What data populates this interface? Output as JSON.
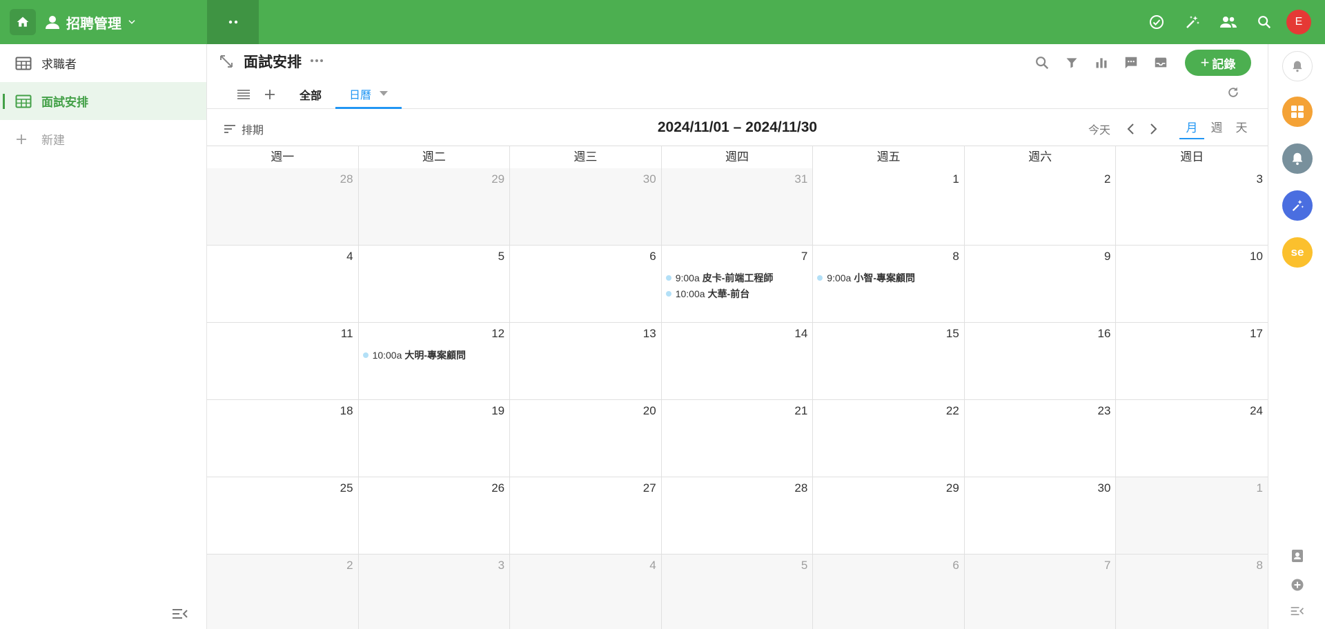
{
  "app": {
    "title": "招聘管理"
  },
  "user": {
    "avatar_letter": "E"
  },
  "sidebar": {
    "items": [
      {
        "label": "求職者"
      },
      {
        "label": "面試安排"
      }
    ],
    "new_label": "新建"
  },
  "view": {
    "title": "面試安排",
    "add_record_label": "記錄",
    "tabs": [
      {
        "label": "全部"
      },
      {
        "label": "日曆"
      }
    ]
  },
  "calendar": {
    "sort_label": "排期",
    "range": "2024/11/01 – 2024/11/30",
    "today_label": "今天",
    "modes": [
      "月",
      "週",
      "天"
    ],
    "weekdays": [
      "週一",
      "週二",
      "週三",
      "週四",
      "週五",
      "週六",
      "週日"
    ],
    "days": [
      {
        "n": "28",
        "out": true
      },
      {
        "n": "29",
        "out": true
      },
      {
        "n": "30",
        "out": true
      },
      {
        "n": "31",
        "out": true
      },
      {
        "n": "1"
      },
      {
        "n": "2"
      },
      {
        "n": "3"
      },
      {
        "n": "4"
      },
      {
        "n": "5"
      },
      {
        "n": "6"
      },
      {
        "n": "7",
        "events": [
          {
            "time": "9:00a",
            "title": "皮卡-前端工程師"
          },
          {
            "time": "10:00a",
            "title": "大華-前台"
          }
        ]
      },
      {
        "n": "8",
        "events": [
          {
            "time": "9:00a",
            "title": "小智-專案顧問"
          }
        ]
      },
      {
        "n": "9"
      },
      {
        "n": "10"
      },
      {
        "n": "11"
      },
      {
        "n": "12",
        "events": [
          {
            "time": "10:00a",
            "title": "大明-專案顧問"
          }
        ]
      },
      {
        "n": "13"
      },
      {
        "n": "14"
      },
      {
        "n": "15"
      },
      {
        "n": "16"
      },
      {
        "n": "17"
      },
      {
        "n": "18"
      },
      {
        "n": "19"
      },
      {
        "n": "20"
      },
      {
        "n": "21"
      },
      {
        "n": "22"
      },
      {
        "n": "23"
      },
      {
        "n": "24"
      },
      {
        "n": "25"
      },
      {
        "n": "26"
      },
      {
        "n": "27"
      },
      {
        "n": "28"
      },
      {
        "n": "29"
      },
      {
        "n": "30"
      },
      {
        "n": "1",
        "out": true
      },
      {
        "n": "2",
        "out": true
      },
      {
        "n": "3",
        "out": true
      },
      {
        "n": "4",
        "out": true
      },
      {
        "n": "5",
        "out": true
      },
      {
        "n": "6",
        "out": true
      },
      {
        "n": "7",
        "out": true
      },
      {
        "n": "8",
        "out": true
      }
    ]
  },
  "rail": {
    "se_label": "se"
  },
  "colors": {
    "brand": "#4caf50",
    "accent": "#2196f3",
    "event_dot": "#b3e0f7"
  }
}
